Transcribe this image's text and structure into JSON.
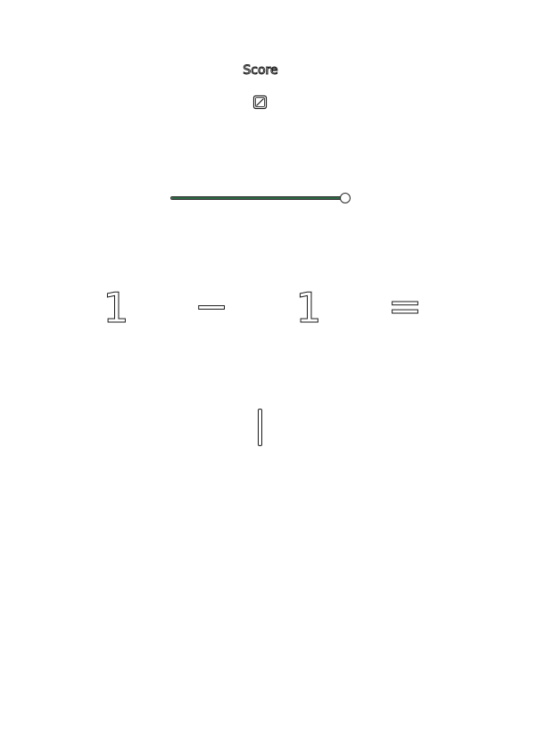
{
  "header": {
    "score_label": "Score"
  },
  "score_toggle": {
    "icon": "edit-square-icon",
    "checked": true
  },
  "slider": {
    "value_fraction": 0.98,
    "accent_color": "#2f6b46"
  },
  "equation": {
    "operand_a": "1",
    "operator": "−",
    "operand_b": "1",
    "equals": "="
  },
  "answer": {
    "value": ""
  }
}
